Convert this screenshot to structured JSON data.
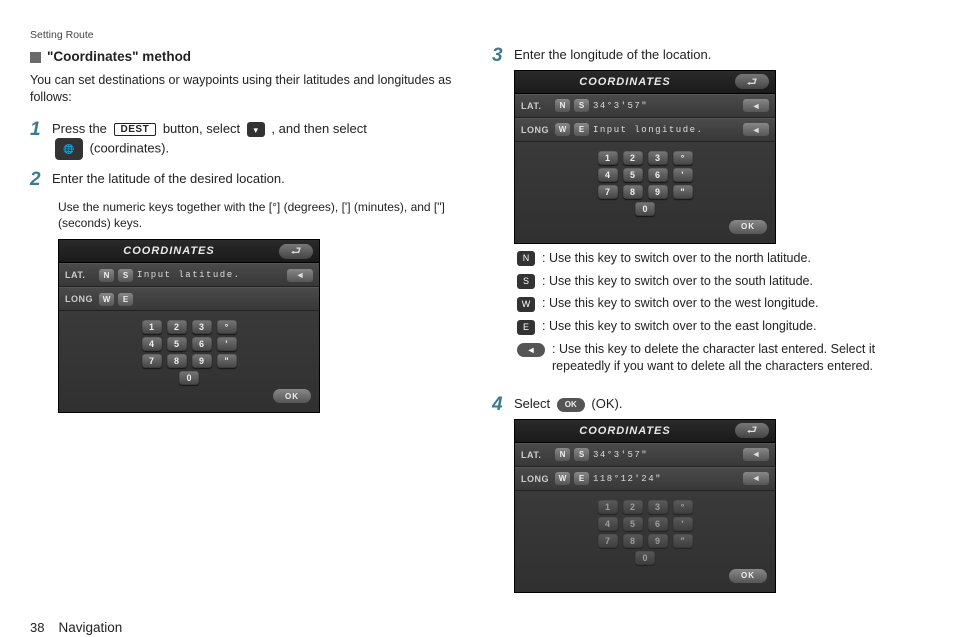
{
  "breadcrumb": "Setting Route",
  "section_title": "\"Coordinates\" method",
  "intro": "You can set destinations or waypoints using their latitudes and longitudes as follows:",
  "left_steps": [
    {
      "n": "1",
      "line_parts": [
        "Press the ",
        "DEST",
        " button, select ",
        " ",
        " , and then select ",
        " ",
        " (coordinates)."
      ]
    },
    {
      "n": "2",
      "line": "Enter the latitude of the desired location.",
      "sub": "Use the numeric keys together with the [°] (degrees), ['] (minutes), and [\"] (seconds) keys."
    }
  ],
  "right_steps": [
    {
      "n": "3",
      "line": "Enter the longitude of the location."
    },
    {
      "n": "4",
      "line_parts": [
        "Select ",
        "OK",
        " (OK)."
      ]
    }
  ],
  "screens": {
    "title": "COORDINATES",
    "s1": {
      "lat_label": "LAT.",
      "n": "N",
      "s": "S",
      "lat_val": "Input latitude.",
      "long_label": "LONG",
      "w": "W",
      "e": "E",
      "long_val": ""
    },
    "s2": {
      "lat_label": "LAT.",
      "n": "N",
      "s": "S",
      "lat_val": "34°3'57\"",
      "long_label": "LONG",
      "w": "W",
      "e": "E",
      "long_val": "Input longitude."
    },
    "s3": {
      "lat_label": "LAT.",
      "n": "N",
      "s": "S",
      "lat_val": "34°3'57\"",
      "long_label": "LONG",
      "w": "W",
      "e": "E",
      "long_val": "118°12'24\""
    },
    "keys": [
      [
        "1",
        "2",
        "3",
        "°"
      ],
      [
        "4",
        "5",
        "6",
        "'"
      ],
      [
        "7",
        "8",
        "9",
        "\""
      ],
      [
        "0"
      ]
    ],
    "ok": "OK",
    "back": "⮐",
    "del": "◄"
  },
  "key_legend": [
    {
      "k": "N",
      "txt": ": Use this key to switch over to the north latitude."
    },
    {
      "k": "S",
      "txt": ": Use this key to switch over to the south latitude."
    },
    {
      "k": "W",
      "txt": ": Use this key to switch over to the west longitude."
    },
    {
      "k": "E",
      "txt": ": Use this key to switch over to the east longitude."
    },
    {
      "k": "◄",
      "txt": ": Use this key to delete the character last entered. Select it repeatedly if you want to delete all the characters entered.",
      "pill": true
    }
  ],
  "footer": {
    "page": "38",
    "section": "Navigation"
  }
}
